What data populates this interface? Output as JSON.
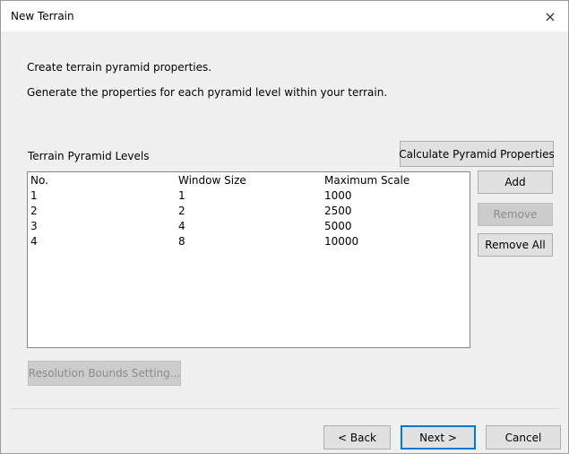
{
  "window": {
    "title": "New Terrain",
    "close_glyph": "×"
  },
  "description": {
    "line1": "Create terrain pyramid properties.",
    "line2": "Generate the properties for each pyramid level within your terrain."
  },
  "pyramid": {
    "section_label": "Terrain Pyramid Levels",
    "calculate_label": "Calculate Pyramid Properties",
    "columns": [
      "No.",
      "Window Size",
      "Maximum Scale"
    ],
    "rows": [
      [
        "1",
        "1",
        "1000"
      ],
      [
        "2",
        "2",
        "2500"
      ],
      [
        "3",
        "4",
        "5000"
      ],
      [
        "4",
        "8",
        "10000"
      ]
    ],
    "add_label": "Add",
    "remove_label": "Remove",
    "remove_all_label": "Remove All",
    "resolution_bounds_label": "Resolution Bounds Setting..."
  },
  "footer": {
    "back_label": "< Back",
    "next_label": "Next >",
    "cancel_label": "Cancel"
  },
  "colors": {
    "window_bg": "#f0f0f0",
    "title_bg": "#ffffff",
    "button_bg": "#e1e1e1",
    "default_button_border": "#0078d7",
    "disabled_text": "#8c8c8c"
  },
  "icons": {
    "close": "close-icon"
  }
}
